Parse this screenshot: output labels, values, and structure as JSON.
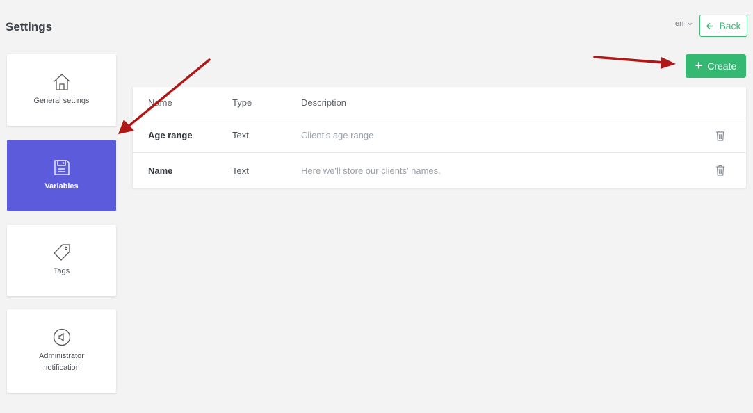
{
  "header": {
    "title": "Settings",
    "language": "en",
    "back_label": "Back"
  },
  "toolbar": {
    "create_label": "Create"
  },
  "sidebar": {
    "items": [
      {
        "label": "General settings",
        "icon": "home-icon",
        "active": false
      },
      {
        "label": "Variables",
        "icon": "floppy-disk-icon",
        "active": true
      },
      {
        "label": "Tags",
        "icon": "tag-icon",
        "active": false
      },
      {
        "label": "Administrator notification",
        "icon": "megaphone-icon",
        "active": false
      }
    ]
  },
  "table": {
    "columns": [
      "Name",
      "Type",
      "Description"
    ],
    "rows": [
      {
        "name": "Age range",
        "type": "Text",
        "description": "Client's age range"
      },
      {
        "name": "Name",
        "type": "Text",
        "description": "Here we'll store our clients' names."
      }
    ]
  },
  "colors": {
    "accent_purple": "#5b5bdb",
    "accent_green": "#35b872",
    "annotation_arrow": "#b01818"
  }
}
